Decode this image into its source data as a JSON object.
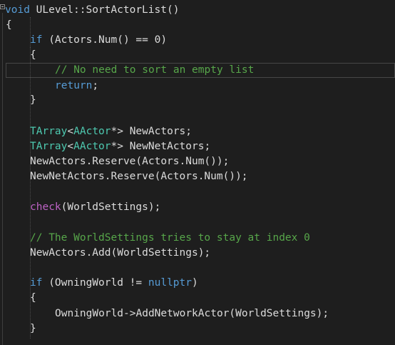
{
  "colors": {
    "background": "#1e1e1e",
    "keyword": "#569cd6",
    "type": "#4ec9b0",
    "macro": "#bd63c5",
    "comment": "#57a64a",
    "plain": "#dcdcdc",
    "number": "#b5cea8"
  },
  "code": {
    "line_1": {
      "kw_void": "void",
      "sig": " ULevel::SortActorList()"
    },
    "line_2": {
      "brace": "{"
    },
    "line_3": {
      "kw_if": "if",
      "rest": " (Actors.Num() == ",
      "num": "0",
      "close": ")"
    },
    "line_4": {
      "brace": "{"
    },
    "line_5": {
      "comment": "// No need to sort an empty list"
    },
    "line_6": {
      "kw_return": "return",
      "semi": ";"
    },
    "line_7": {
      "brace": "}"
    },
    "line_9": {
      "type_tarray": "TArray",
      "lt": "<",
      "type_aactor": "AActor",
      "rest": "*> NewActors;"
    },
    "line_10": {
      "type_tarray": "TArray",
      "lt": "<",
      "type_aactor": "AActor",
      "rest": "*> NewNetActors;"
    },
    "line_11": {
      "text": "NewActors.Reserve(Actors.Num());"
    },
    "line_12": {
      "text": "NewNetActors.Reserve(Actors.Num());"
    },
    "line_14": {
      "macro": "check",
      "rest": "(WorldSettings);"
    },
    "line_16": {
      "comment": "// The WorldSettings tries to stay at index 0"
    },
    "line_17": {
      "text": "NewActors.Add(WorldSettings);"
    },
    "line_19": {
      "kw_if": "if",
      "rest": " (OwningWorld != ",
      "kw_nullptr": "nullptr",
      "close": ")"
    },
    "line_20": {
      "brace": "{"
    },
    "line_21": {
      "text": "OwningWorld->AddNetworkActor(WorldSettings);"
    },
    "line_22": {
      "brace": "}"
    }
  }
}
